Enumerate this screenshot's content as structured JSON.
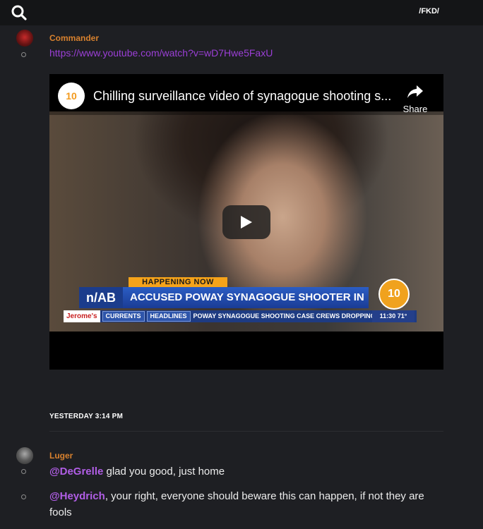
{
  "topbar": {
    "channel": "/FKD/"
  },
  "posts": [
    {
      "author": "Commander",
      "link": "https://www.youtube.com/watch?v=wD7Hwe5FaxU",
      "video": {
        "title": "Chilling surveillance video of synagogue shooting s...",
        "share_label": "Share",
        "channel_logo": "10",
        "overlay": {
          "happening_now": "HAPPENING NOW",
          "side_text": "n/AB",
          "headline": "ACCUSED POWAY SYNAGOGUE SHOOTER IN COURT",
          "logo_text": "10",
          "ticker_sponsor": "Jerome's",
          "ticker_tag_1": "CURRENTS",
          "ticker_tag_2": "HEADLINES",
          "ticker_text": "POWAY SYNAGOGUE SHOOTING CASE  CREWS DROPPING LA",
          "ticker_time": "11:30  71°"
        }
      }
    }
  ],
  "date_divider": "YESTERDAY 3:14 PM",
  "post2": {
    "author": "Luger",
    "messages": [
      {
        "mention": "@DeGrelle",
        "text": " glad you good, just home"
      },
      {
        "mention": "@Heydrich",
        "text": ", your right, everyone should beware this can happen, if not they are fools"
      }
    ]
  },
  "icons": {
    "search": "search-icon",
    "share": "share-icon",
    "play": "play-icon"
  },
  "colors": {
    "background": "#1e1f23",
    "author": "#d8812e",
    "link": "#9b3fd6",
    "mention": "#b15ee6"
  }
}
